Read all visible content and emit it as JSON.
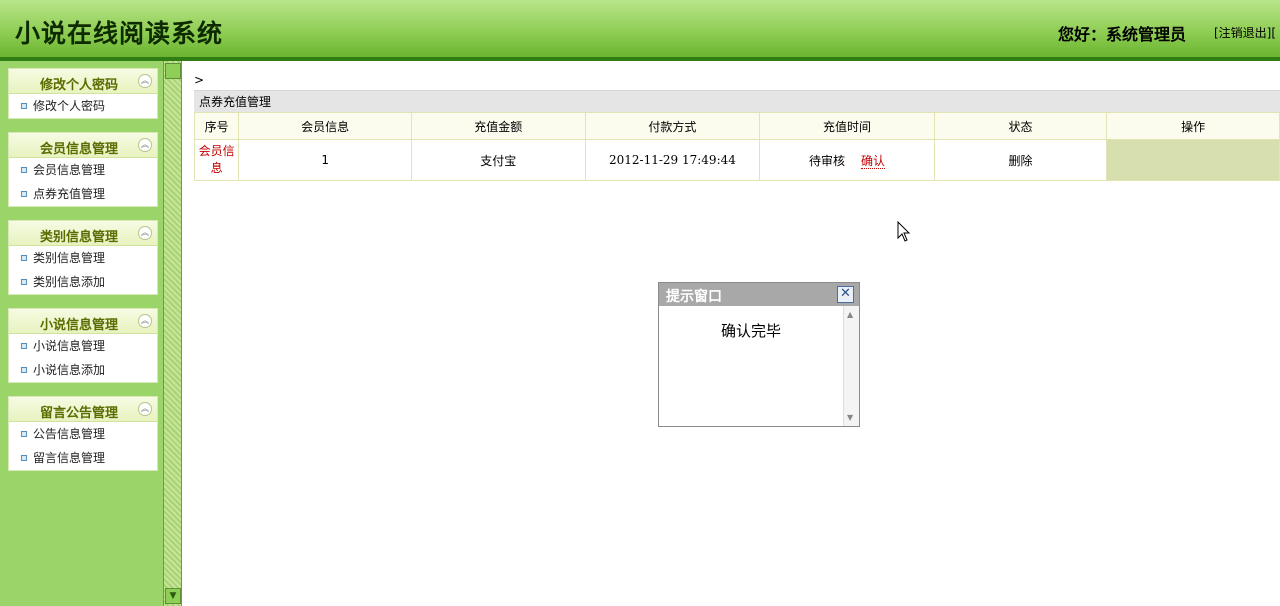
{
  "header": {
    "title": "小说在线阅读系统",
    "greeting": "您好：系统管理员",
    "logout": "[注销退出]["
  },
  "sidebar": {
    "groups": [
      {
        "title": "修改个人密码",
        "items": [
          "修改个人密码"
        ]
      },
      {
        "title": "会员信息管理",
        "items": [
          "会员信息管理",
          "点券充值管理"
        ]
      },
      {
        "title": "类别信息管理",
        "items": [
          "类别信息管理",
          "类别信息添加"
        ]
      },
      {
        "title": "小说信息管理",
        "items": [
          "小说信息管理",
          "小说信息添加"
        ]
      },
      {
        "title": "留言公告管理",
        "items": [
          "公告信息管理",
          "留言信息管理"
        ]
      }
    ],
    "collapse_glyph": "︽"
  },
  "main": {
    "breadcrumb": ">",
    "panel_title": "点券充值管理",
    "columns": [
      "序号",
      "会员信息",
      "充值金额",
      "付款方式",
      "充值时间",
      "状态",
      "操作"
    ],
    "rows": [
      {
        "index_link": "会员信息",
        "member": "1",
        "amount": "支付宝",
        "payment": "2012-11-29 17:49:44",
        "time_status": "待审核",
        "confirm_link": "确认",
        "status": "删除",
        "operation": ""
      }
    ]
  },
  "dialog": {
    "title": "提示窗口",
    "message": "确认完毕",
    "close_glyph": "✕"
  },
  "colors": {
    "header_green": "#8fce55",
    "sidebar_green": "#9bd468",
    "link_red": "#c00000"
  }
}
